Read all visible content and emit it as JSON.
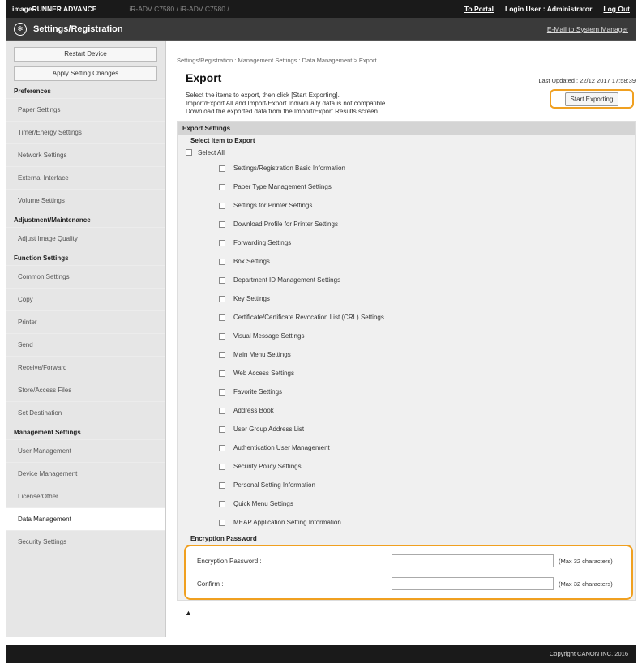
{
  "topbar": {
    "brand": "imageRUNNER ADVANCE",
    "models": "iR-ADV C7580 / iR-ADV C7580 /",
    "to_portal": "To Portal",
    "login_user": "Login User :",
    "user_name": "Administrator",
    "logout": "Log Out"
  },
  "titlebar": {
    "title": "Settings/Registration",
    "email_link": "E-Mail to System Manager"
  },
  "sidebar": {
    "buttons": [
      "Restart Device",
      "Apply Setting Changes"
    ],
    "groups": [
      {
        "label": "Preferences",
        "items": [
          "Paper Settings",
          "Timer/Energy Settings",
          "Network Settings",
          "External Interface",
          "Volume Settings"
        ]
      },
      {
        "label": "Adjustment/Maintenance",
        "items": [
          "Adjust Image Quality"
        ]
      },
      {
        "label": "Function Settings",
        "items": [
          "Common Settings",
          "Copy",
          "Printer",
          "Send",
          "Receive/Forward",
          "Store/Access Files",
          "Set Destination"
        ]
      },
      {
        "label": "Management Settings",
        "items": [
          "User Management",
          "Device Management",
          "License/Other",
          "Data Management",
          "Security Settings"
        ]
      }
    ],
    "selected": "Data Management"
  },
  "main": {
    "breadcrumb": "Settings/Registration : Management Settings : Data Management > Export",
    "title": "Export",
    "last_updated": "Last Updated : 22/12 2017 17:58:39",
    "description": [
      "Select the items to export, then click [Start Exporting].",
      "Import/Export All and Import/Export Individually data is not compatible.",
      "Download the exported data from the Import/Export Results screen."
    ],
    "start_button": "Start Exporting",
    "export_settings": {
      "header": "Export Settings",
      "select_item": "Select Item to Export",
      "select_all": "Select All",
      "items": [
        "Settings/Registration Basic Information",
        "Paper Type Management Settings",
        "Settings for Printer Settings",
        "Download Profile for Printer Settings",
        "Forwarding Settings",
        "Box Settings",
        "Department ID Management Settings",
        "Key Settings",
        "Certificate/Certificate Revocation List (CRL) Settings",
        "Visual Message Settings",
        "Main Menu Settings",
        "Web Access Settings",
        "Favorite Settings",
        "Address Book",
        "User Group Address List",
        "Authentication User Management",
        "Security Policy Settings",
        "Personal Setting Information",
        "Quick Menu Settings",
        "MEAP Application Setting Information"
      ]
    },
    "encryption": {
      "header": "Encryption Password",
      "password_label": "Encryption Password :",
      "password_value": "",
      "confirm_label": "Confirm :",
      "confirm_value": "",
      "max_note": "(Max 32 characters)"
    },
    "to_top": "▲"
  },
  "footer": {
    "copyright": "Copyright CANON INC. 2016"
  },
  "colors": {
    "highlight": "#f0a020",
    "topbar": "#1a1a1a",
    "titlebar": "#3a3a3a"
  }
}
